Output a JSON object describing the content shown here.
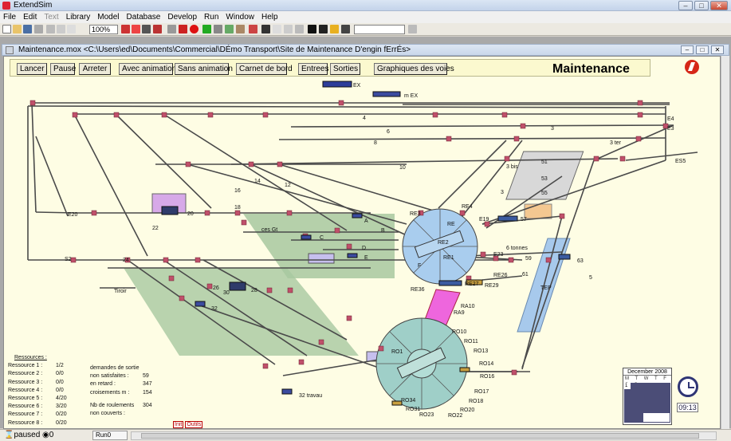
{
  "app": {
    "title": "ExtendSim"
  },
  "menu": [
    "File",
    "Edit",
    "Text",
    "Library",
    "Model",
    "Database",
    "Develop",
    "Run",
    "Window",
    "Help"
  ],
  "toolbar": {
    "zoom": "100%"
  },
  "document": {
    "title": "Maintenance.mox   <C:\\Users\\ed\\Documents\\Commercial\\DÉmo Transport\\Site de Maintenance D'engin fErrÉs>"
  },
  "controls": {
    "buttons": [
      "Lancer",
      "Pause",
      "Arreter",
      "Avec animation",
      "Sans animation",
      "Carnet de bord",
      "Entrees",
      "Sorties",
      "Graphiques des voies"
    ],
    "title": "Maintenance"
  },
  "track_labels": [
    "EX",
    "m EX",
    "4",
    "6",
    "8",
    "3",
    "E4",
    "E3",
    "3 ter",
    "ES5",
    "10",
    "3 bis",
    "51",
    "53",
    "55",
    "14",
    "12",
    "16",
    "18",
    "E20",
    "20",
    "22",
    "RE3",
    "RE4",
    "RE",
    "E19",
    "57",
    "RE2",
    "RE1",
    "E23",
    "59",
    "61",
    "63",
    "5",
    "6 tonnes",
    "TEP",
    "F",
    "3",
    "A",
    "B",
    "C",
    "D",
    "E",
    "ces Gt",
    "24",
    "S2",
    "Tiroir",
    "32",
    "30",
    "28",
    "26",
    "RE36",
    "RE26",
    "RE29",
    "RA10",
    "RA9",
    "RO1",
    "RO10",
    "RO11",
    "RO13",
    "RO14",
    "RO16",
    "RO17",
    "RO18",
    "RO20",
    "RO22",
    "RO23",
    "RO31",
    "RO34",
    "32 travau",
    "RE27"
  ],
  "resources": {
    "header": "Ressources :",
    "items": [
      {
        "name": "Ressource 1 :",
        "value": "1/2"
      },
      {
        "name": "Ressource 2 :",
        "value": "0/0"
      },
      {
        "name": "Ressource 3 :",
        "value": "0/0"
      },
      {
        "name": "Ressource 4 :",
        "value": "0/0"
      },
      {
        "name": "Ressource 5 :",
        "value": "4/20"
      },
      {
        "name": "Ressource 6 :",
        "value": "3/20"
      },
      {
        "name": "Ressource 7 :",
        "value": "0/20"
      },
      {
        "name": "Ressource 8 :",
        "value": "0/20"
      }
    ]
  },
  "stats": {
    "demandes_label": "demandes de sortie",
    "non_satisfaites_label": "non satisfaites :",
    "non_satisfaites": "59",
    "en_retard_label": "en retard :",
    "en_retard": "347",
    "croisements_label": "croisements  m :",
    "croisements": "154",
    "nb_roulements_label": "Nb de roulements",
    "nb_roulements": "304",
    "non_couverts_label": "non couverts :"
  },
  "io": {
    "init": "Init",
    "outils": "Outils"
  },
  "calendar": {
    "month": "December 2008",
    "days": "M T W T F S S",
    "first": "1"
  },
  "clock": {
    "time": "09:13"
  },
  "status": {
    "state": "paused",
    "count": "0",
    "run": "Run0"
  },
  "colors": {
    "canvas": "#fefde4",
    "node": "#c0506a",
    "turntable_top": "#a9cdee",
    "turntable_bottom": "#9fcfc8",
    "zone": "#a8c8a0",
    "magenta": "#ee66dd"
  }
}
